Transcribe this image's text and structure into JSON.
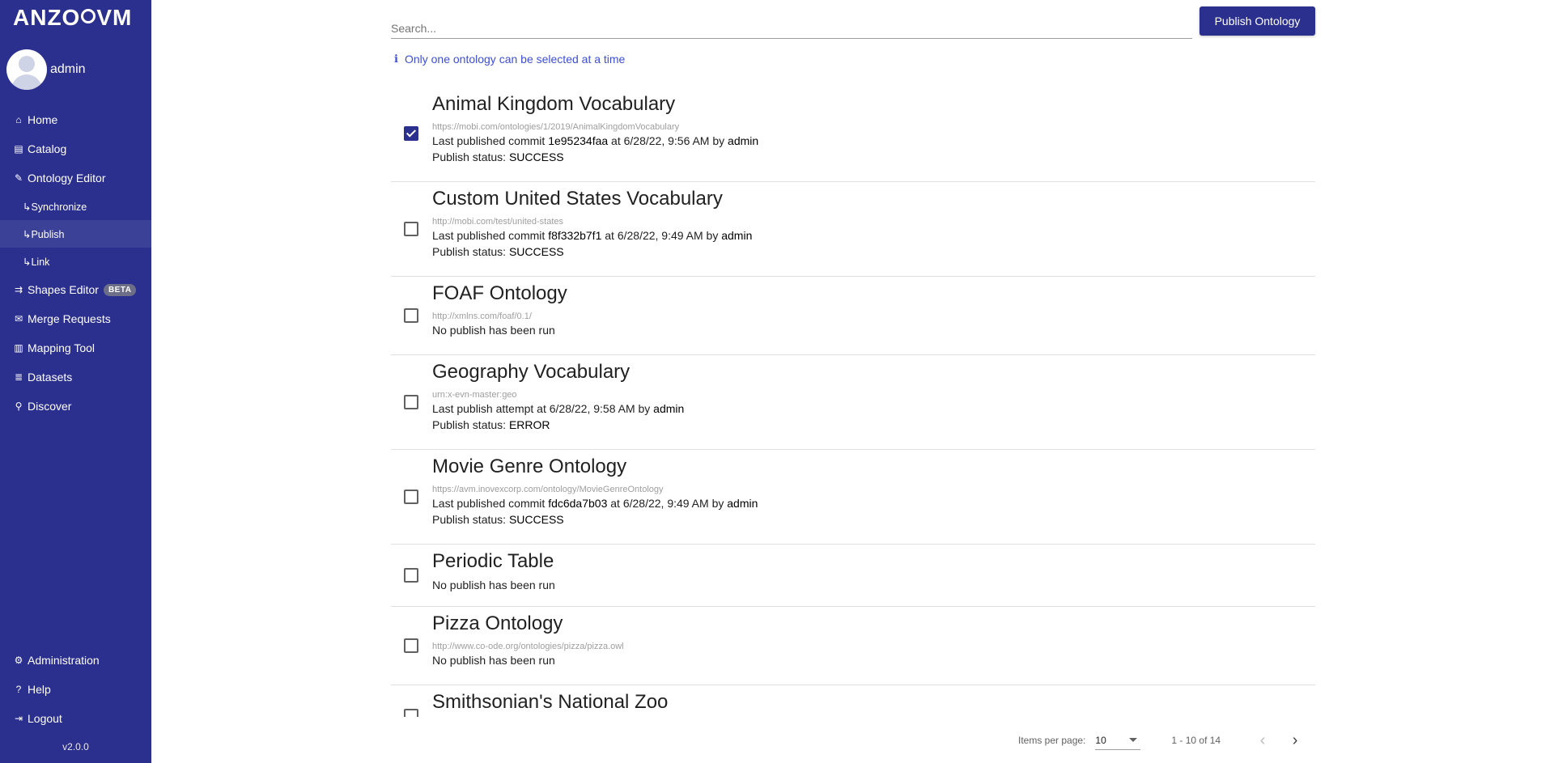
{
  "sidebar": {
    "logo": "ANZO",
    "logo_suffix": "VM",
    "user_name": "admin",
    "items": [
      {
        "icon": "home-icon",
        "glyph": "⌂",
        "label": "Home"
      },
      {
        "icon": "book-icon",
        "glyph": "▤",
        "label": "Catalog"
      },
      {
        "icon": "edit-icon",
        "glyph": "✎",
        "label": "Ontology Editor"
      }
    ],
    "sub_items": [
      {
        "label": "↳Synchronize"
      },
      {
        "label": "↳Publish"
      },
      {
        "label": "↳Link"
      }
    ],
    "items2": [
      {
        "icon": "shapes-icon",
        "glyph": "⇉",
        "label": "Shapes Editor",
        "badge": "BETA"
      },
      {
        "icon": "envelope-icon",
        "glyph": "✉",
        "label": "Merge Requests"
      },
      {
        "icon": "map-icon",
        "glyph": "▥",
        "label": "Mapping Tool"
      },
      {
        "icon": "database-icon",
        "glyph": "≣",
        "label": "Datasets"
      },
      {
        "icon": "search-icon",
        "glyph": "⚲",
        "label": "Discover"
      }
    ],
    "bottom": [
      {
        "icon": "gear-icon",
        "glyph": "⚙",
        "label": "Administration"
      },
      {
        "icon": "help-icon",
        "glyph": "?",
        "label": "Help"
      },
      {
        "icon": "logout-icon",
        "glyph": "⇥",
        "label": "Logout"
      }
    ],
    "version": "v2.0.0"
  },
  "search": {
    "placeholder": "Search..."
  },
  "publish_button": "Publish Ontology",
  "info_message": "Only one ontology can be selected at a time",
  "ontologies": [
    {
      "title": "Animal Kingdom Vocabulary",
      "iri": "https://mobi.com/ontologies/1/2019/AnimalKingdomVocabulary",
      "line1_prefix": "Last published commit ",
      "commit": "1e95234faa",
      "line1_mid": " at 6/28/22, 9:56 AM by ",
      "user": "admin",
      "status_prefix": "Publish status: ",
      "status": "SUCCESS",
      "checked": true
    },
    {
      "title": "Custom United States Vocabulary",
      "iri": "http://mobi.com/test/united-states",
      "line1_prefix": "Last published commit ",
      "commit": "f8f332b7f1",
      "line1_mid": " at 6/28/22, 9:49 AM by ",
      "user": "admin",
      "status_prefix": "Publish status: ",
      "status": "SUCCESS",
      "checked": false
    },
    {
      "title": "FOAF Ontology",
      "iri": "http://xmlns.com/foaf/0.1/",
      "no_publish": "No publish has been run",
      "checked": false
    },
    {
      "title": "Geography Vocabulary",
      "iri": "urn:x-evn-master:geo",
      "line1_prefix": "Last publish attempt at 6/28/22, 9:58 AM by ",
      "commit": "",
      "line1_mid": "",
      "user": "admin",
      "status_prefix": "Publish status: ",
      "status": "ERROR",
      "checked": false
    },
    {
      "title": "Movie Genre Ontology",
      "iri": "https://avm.inovexcorp.com/ontology/MovieGenreOntology",
      "line1_prefix": "Last published commit ",
      "commit": "fdc6da7b03",
      "line1_mid": " at 6/28/22, 9:49 AM by ",
      "user": "admin",
      "status_prefix": "Publish status: ",
      "status": "SUCCESS",
      "checked": false
    },
    {
      "title": "Periodic Table",
      "iri": "",
      "no_publish": "No publish has been run",
      "checked": false
    },
    {
      "title": "Pizza Ontology",
      "iri": "http://www.co-ode.org/ontologies/pizza/pizza.owl",
      "no_publish": "No publish has been run",
      "checked": false
    },
    {
      "title": "Smithsonian's National Zoo",
      "iri": "",
      "checked": false
    }
  ],
  "paginator": {
    "items_per_page_label": "Items per page:",
    "page_size": "10",
    "range": "1 - 10 of 14"
  }
}
